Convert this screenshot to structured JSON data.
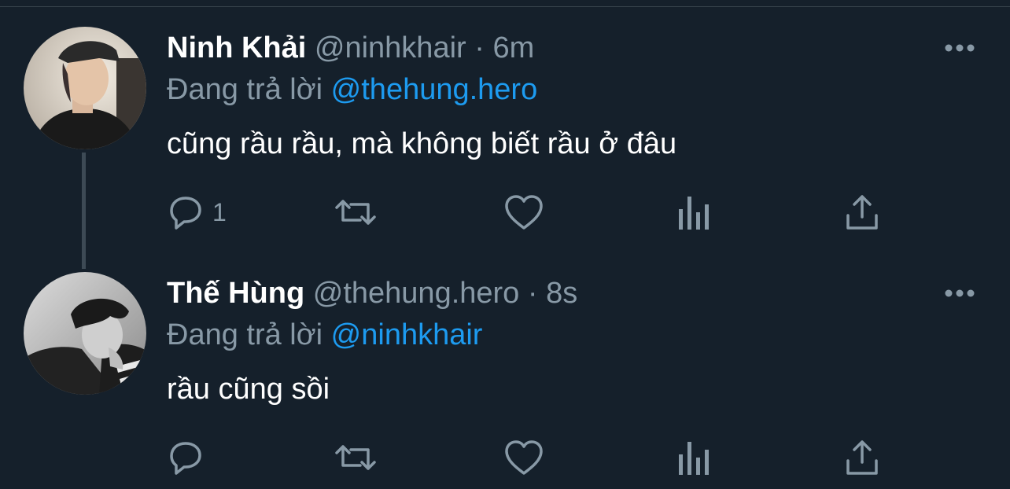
{
  "tweets": [
    {
      "display_name": "Ninh Khải",
      "handle": "@ninhkhair",
      "separator": "·",
      "time": "6m",
      "reply_prefix": "Đang trả lời",
      "reply_to": "@thehung.hero",
      "text": "cũng rầu rầu, mà không biết rầu ở đâu",
      "reply_count": "1"
    },
    {
      "display_name": "Thế Hùng",
      "handle": "@thehung.hero",
      "separator": "·",
      "time": "8s",
      "reply_prefix": "Đang trả lời",
      "reply_to": "@ninhkhair",
      "text": "rầu cũng sồi",
      "reply_count": ""
    }
  ],
  "icons": {
    "reply": "speech-bubble-icon",
    "retweet": "retweet-arrows-icon",
    "like": "heart-icon",
    "analytics": "bar-chart-icon",
    "share": "share-upload-icon",
    "more": "three-dots-icon"
  },
  "colors": {
    "background": "#15202b",
    "text_primary": "#ffffff",
    "text_secondary": "#8899a6",
    "mention": "#1d9bf0",
    "thread_line": "#3d4a55"
  }
}
